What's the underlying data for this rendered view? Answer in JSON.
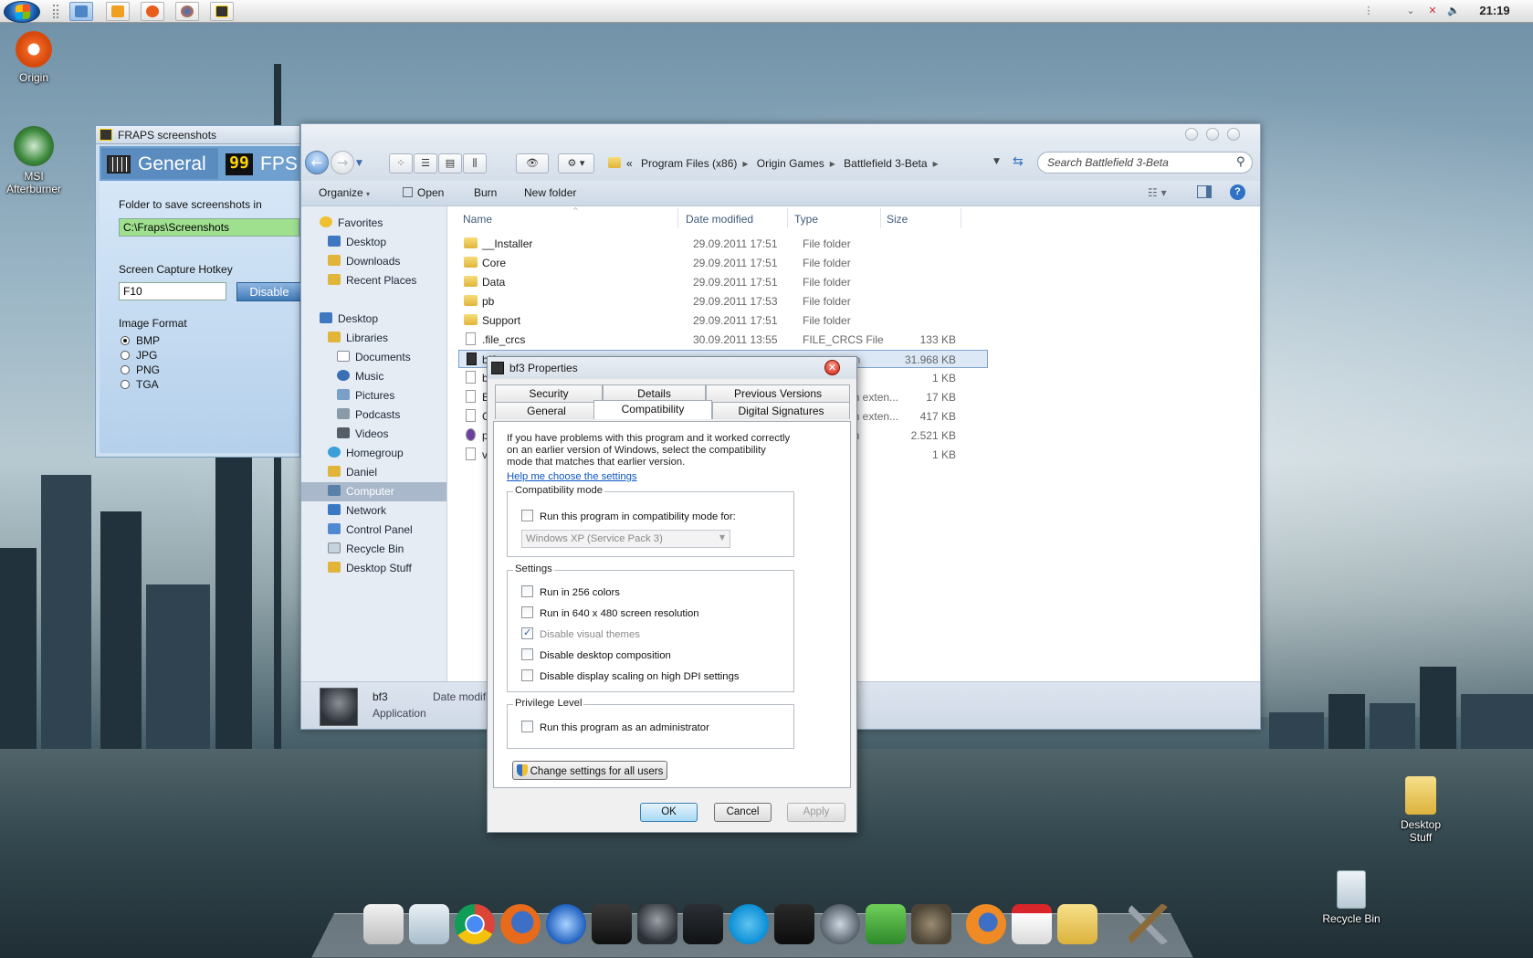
{
  "taskbar": {
    "clock": "21:19",
    "tray_icons": [
      "grip-icon",
      "expand-arrow-icon",
      "network-disconnected-icon",
      "volume-icon"
    ]
  },
  "desktop": {
    "icons": [
      {
        "name": "origin",
        "label": "Origin"
      },
      {
        "name": "msi-afterburner",
        "label": "MSI Afterburner"
      },
      {
        "name": "desktop-stuff",
        "label": "Desktop Stuff"
      },
      {
        "name": "recycle-bin",
        "label": "Recycle Bin"
      }
    ]
  },
  "fraps": {
    "title": "FRAPS screenshots",
    "tab_general": "General",
    "tab_fps_badge": "99",
    "tab_fps": "FPS",
    "folder_label": "Folder to save screenshots in",
    "folder_value": "C:\\Fraps\\Screenshots",
    "hotkey_label": "Screen Capture Hotkey",
    "hotkey_value": "F10",
    "disable_button": "Disable",
    "format_label": "Image Format",
    "formats": [
      "BMP",
      "JPG",
      "PNG",
      "TGA"
    ],
    "selected_format": "BMP"
  },
  "explorer": {
    "breadcrumb": {
      "prefix": "«",
      "parts": [
        "Program Files (x86)",
        "Origin Games",
        "Battlefield 3-Beta"
      ]
    },
    "search_placeholder": "Search Battlefield 3-Beta",
    "commands": [
      "Organize",
      "Open",
      "Burn",
      "New folder"
    ],
    "nav": {
      "favorites_header": "Favorites",
      "favorites": [
        "Desktop",
        "Downloads",
        "Recent Places"
      ],
      "desktop_header": "Desktop",
      "libraries": "Libraries",
      "library_items": [
        "Documents",
        "Music",
        "Pictures",
        "Podcasts",
        "Videos"
      ],
      "other": [
        "Homegroup",
        "Daniel",
        "Computer",
        "Network",
        "Control Panel",
        "Recycle Bin",
        "Desktop Stuff"
      ],
      "selected": "Computer"
    },
    "columns": [
      "Name",
      "Date modified",
      "Type",
      "Size"
    ],
    "rows": [
      {
        "name": "__Installer",
        "date": "29.09.2011 17:51",
        "type": "File folder",
        "size": ""
      },
      {
        "name": "Core",
        "date": "29.09.2011 17:51",
        "type": "File folder",
        "size": ""
      },
      {
        "name": "Data",
        "date": "29.09.2011 17:51",
        "type": "File folder",
        "size": ""
      },
      {
        "name": "pb",
        "date": "29.09.2011 17:53",
        "type": "File folder",
        "size": ""
      },
      {
        "name": "Support",
        "date": "29.09.2011 17:51",
        "type": "File folder",
        "size": ""
      },
      {
        "name": ".file_crcs",
        "date": "30.09.2011 13:55",
        "type": "FILE_CRCS File",
        "size": "133 KB"
      },
      {
        "name": "bf3",
        "date": "",
        "type": "on",
        "size": "31.968 KB"
      },
      {
        "name": "b",
        "date": "",
        "type": "",
        "size": "1 KB"
      },
      {
        "name": "B",
        "date": "",
        "type": "on exten...",
        "size": "17 KB"
      },
      {
        "name": "C",
        "date": "",
        "type": "on exten...",
        "size": "417 KB"
      },
      {
        "name": "p",
        "date": "",
        "type": "on",
        "size": "2.521 KB"
      },
      {
        "name": "v",
        "date": "",
        "type": "",
        "size": "1 KB"
      }
    ],
    "details": {
      "name": "bf3",
      "kind": "Application",
      "date_label": "Date modifi"
    }
  },
  "properties": {
    "title": "bf3 Properties",
    "tabs_top": [
      "Security",
      "Details",
      "Previous Versions"
    ],
    "tabs_bottom": [
      "General",
      "Compatibility",
      "Digital Signatures"
    ],
    "active_tab": "Compatibility",
    "intro": "If you have problems with this program and it worked correctly on an earlier version of Windows, select the compatibility mode that matches that earlier version.",
    "help_link": "Help me choose the settings",
    "compat_group": "Compatibility mode",
    "compat_check": "Run this program in compatibility mode for:",
    "compat_select": "Windows XP (Service Pack 3)",
    "settings_group": "Settings",
    "settings": [
      {
        "label": "Run in 256 colors",
        "checked": false,
        "disabled": false
      },
      {
        "label": "Run in 640 x 480 screen resolution",
        "checked": false,
        "disabled": false
      },
      {
        "label": "Disable visual themes",
        "checked": true,
        "disabled": true
      },
      {
        "label": "Disable desktop composition",
        "checked": false,
        "disabled": false
      },
      {
        "label": "Disable display scaling on high DPI settings",
        "checked": false,
        "disabled": false
      }
    ],
    "privilege_group": "Privilege Level",
    "privilege_check": "Run this program as an administrator",
    "all_users_button": "Change settings for all users",
    "ok": "OK",
    "cancel": "Cancel",
    "apply": "Apply"
  },
  "dock": {
    "icons": [
      "notepad-icon",
      "recycle-bin-icon",
      "chrome-icon",
      "firefox-icon",
      "itunes-icon",
      "steam-icon",
      "battlefield-icon",
      "battlefield2-icon",
      "skype-icon",
      "gta-iv-icon",
      "speedometer-icon",
      "evernote-icon",
      "gimp-icon",
      "firefox-alt-icon",
      "pdf-icon",
      "folder-icon",
      "tools-icon"
    ]
  }
}
